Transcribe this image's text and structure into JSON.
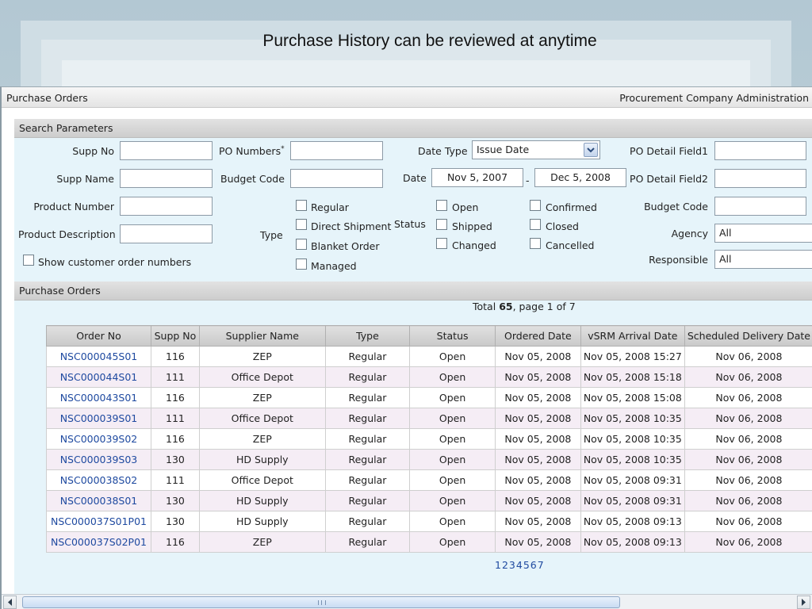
{
  "slide": {
    "title": "Purchase History can be reviewed at anytime"
  },
  "topbar": {
    "left_title": "Purchase Orders",
    "right_link": "Procurement Company Administration"
  },
  "search": {
    "header": "Search Parameters",
    "supp_no_label": "Supp No",
    "supp_name_label": "Supp Name",
    "product_number_label": "Product Number",
    "product_description_label": "Product Description",
    "show_customer_label": "Show customer order numbers",
    "po_numbers_label": "PO Numbers",
    "po_numbers_mark": "*",
    "budget_code_label": "Budget Code",
    "type_label": "Type",
    "type_options": [
      "Regular",
      "Direct Shipment",
      "Blanket Order",
      "Managed"
    ],
    "date_type_label": "Date Type",
    "date_type_value": "Issue Date",
    "date_label": "Date",
    "date_from": "Nov 5, 2007",
    "date_sep": "-",
    "date_to": "Dec 5, 2008",
    "status_label": "Status",
    "status_options": [
      "Open",
      "Shipped",
      "Changed",
      "Confirmed",
      "Closed",
      "Cancelled"
    ],
    "po_detail_field1_label": "PO Detail Field1",
    "po_detail_field2_label": "PO Detail Field2",
    "budget_code2_label": "Budget Code",
    "agency_label": "Agency",
    "agency_value": "All",
    "responsible_label": "Responsible",
    "responsible_value": "All"
  },
  "results": {
    "header": "Purchase Orders",
    "total_prefix": "Total",
    "total_count": "65",
    "page_text": ", page",
    "page_current": "1",
    "page_of": "of 7",
    "columns": [
      "Order No",
      "Supp No",
      "Supplier Name",
      "Type",
      "Status",
      "Ordered Date",
      "vSRM Arrival Date",
      "Scheduled Delivery Date"
    ],
    "rows": [
      [
        "NSC000045S01",
        "116",
        "ZEP",
        "Regular",
        "Open",
        "Nov 05, 2008",
        "Nov 05, 2008 15:27",
        "Nov 06, 2008"
      ],
      [
        "NSC000044S01",
        "111",
        "Office Depot",
        "Regular",
        "Open",
        "Nov 05, 2008",
        "Nov 05, 2008 15:18",
        "Nov 06, 2008"
      ],
      [
        "NSC000043S01",
        "116",
        "ZEP",
        "Regular",
        "Open",
        "Nov 05, 2008",
        "Nov 05, 2008 15:08",
        "Nov 06, 2008"
      ],
      [
        "NSC000039S01",
        "111",
        "Office Depot",
        "Regular",
        "Open",
        "Nov 05, 2008",
        "Nov 05, 2008 10:35",
        "Nov 06, 2008"
      ],
      [
        "NSC000039S02",
        "116",
        "ZEP",
        "Regular",
        "Open",
        "Nov 05, 2008",
        "Nov 05, 2008 10:35",
        "Nov 06, 2008"
      ],
      [
        "NSC000039S03",
        "130",
        "HD Supply",
        "Regular",
        "Open",
        "Nov 05, 2008",
        "Nov 05, 2008 10:35",
        "Nov 06, 2008"
      ],
      [
        "NSC000038S02",
        "111",
        "Office Depot",
        "Regular",
        "Open",
        "Nov 05, 2008",
        "Nov 05, 2008 09:31",
        "Nov 06, 2008"
      ],
      [
        "NSC000038S01",
        "130",
        "HD Supply",
        "Regular",
        "Open",
        "Nov 05, 2008",
        "Nov 05, 2008 09:31",
        "Nov 06, 2008"
      ],
      [
        "NSC000037S01P01",
        "130",
        "HD Supply",
        "Regular",
        "Open",
        "Nov 05, 2008",
        "Nov 05, 2008 09:13",
        "Nov 06, 2008"
      ],
      [
        "NSC000037S02P01",
        "116",
        "ZEP",
        "Regular",
        "Open",
        "Nov 05, 2008",
        "Nov 05, 2008 09:13",
        "Nov 06, 2008"
      ]
    ],
    "pages": [
      "1",
      "2",
      "3",
      "4",
      "5",
      "6",
      "7"
    ]
  },
  "icons": {
    "dropdown": "chevron-down-icon",
    "scroll_left": "arrow-left-icon",
    "scroll_right": "arrow-right-icon"
  },
  "colors": {
    "panel_bg": "#e6f4fa",
    "link": "#1f4aa0",
    "alt_row": "#f5edf5"
  }
}
